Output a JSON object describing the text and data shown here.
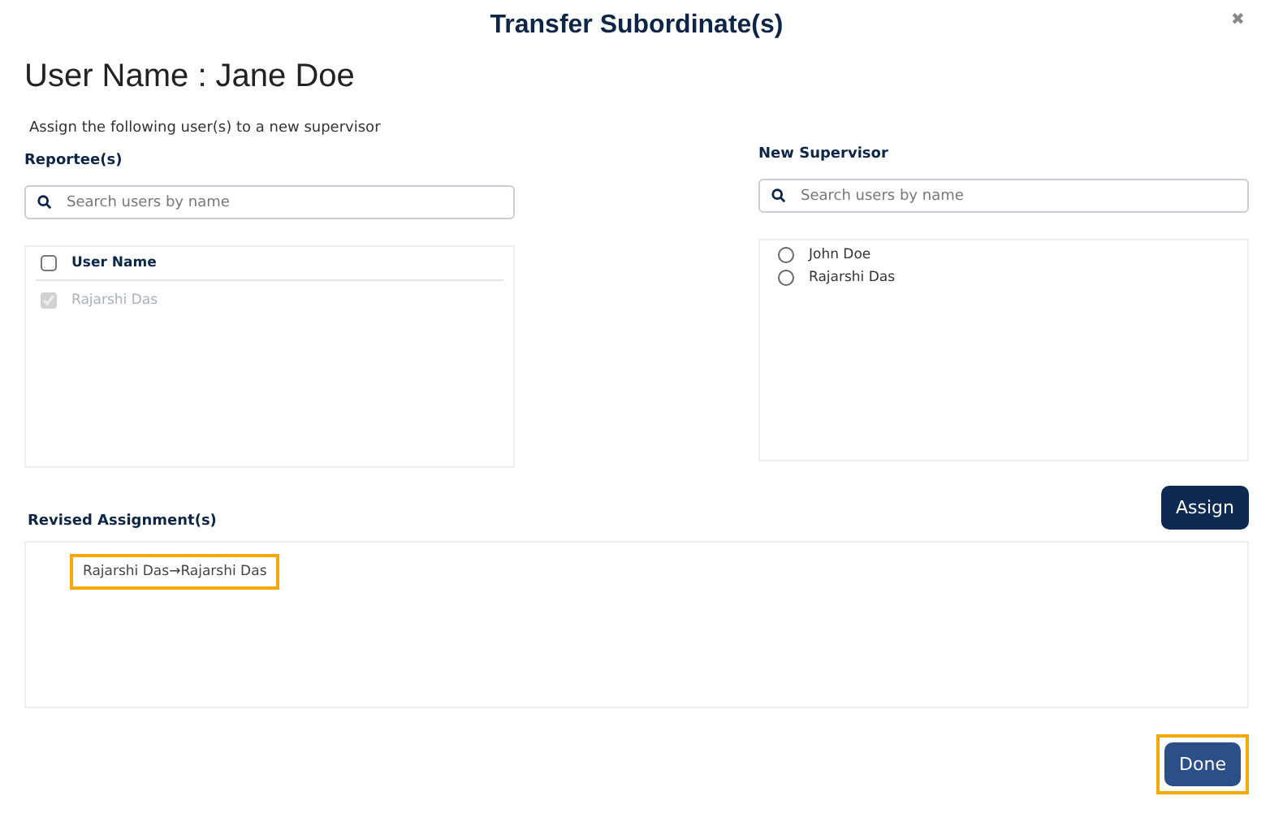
{
  "dialog": {
    "title": "Transfer Subordinate(s)",
    "close": "✖"
  },
  "heading": "User Name : Jane Doe",
  "instruction": "Assign the following user(s) to a new supervisor",
  "reportees": {
    "label": "Reportee(s)",
    "search": {
      "placeholder": "Search users by name"
    },
    "header": {
      "label": "User Name",
      "checked": false
    },
    "rows": [
      {
        "name": "Rajarshi Das",
        "checked": true,
        "disabled": true
      }
    ]
  },
  "supervisor": {
    "label": "New Supervisor",
    "search": {
      "placeholder": "Search users by name"
    },
    "options": [
      {
        "name": "John Doe",
        "selected": false
      },
      {
        "name": "Rajarshi Das",
        "selected": false
      }
    ]
  },
  "assign_button": "Assign",
  "revised": {
    "label": "Revised Assignment(s)",
    "items": [
      {
        "from": "Rajarshi Das",
        "arrow": "→",
        "to": "Rajarshi Das",
        "highlighted": true
      }
    ]
  },
  "done_button": {
    "label": "Done",
    "highlighted": true
  }
}
